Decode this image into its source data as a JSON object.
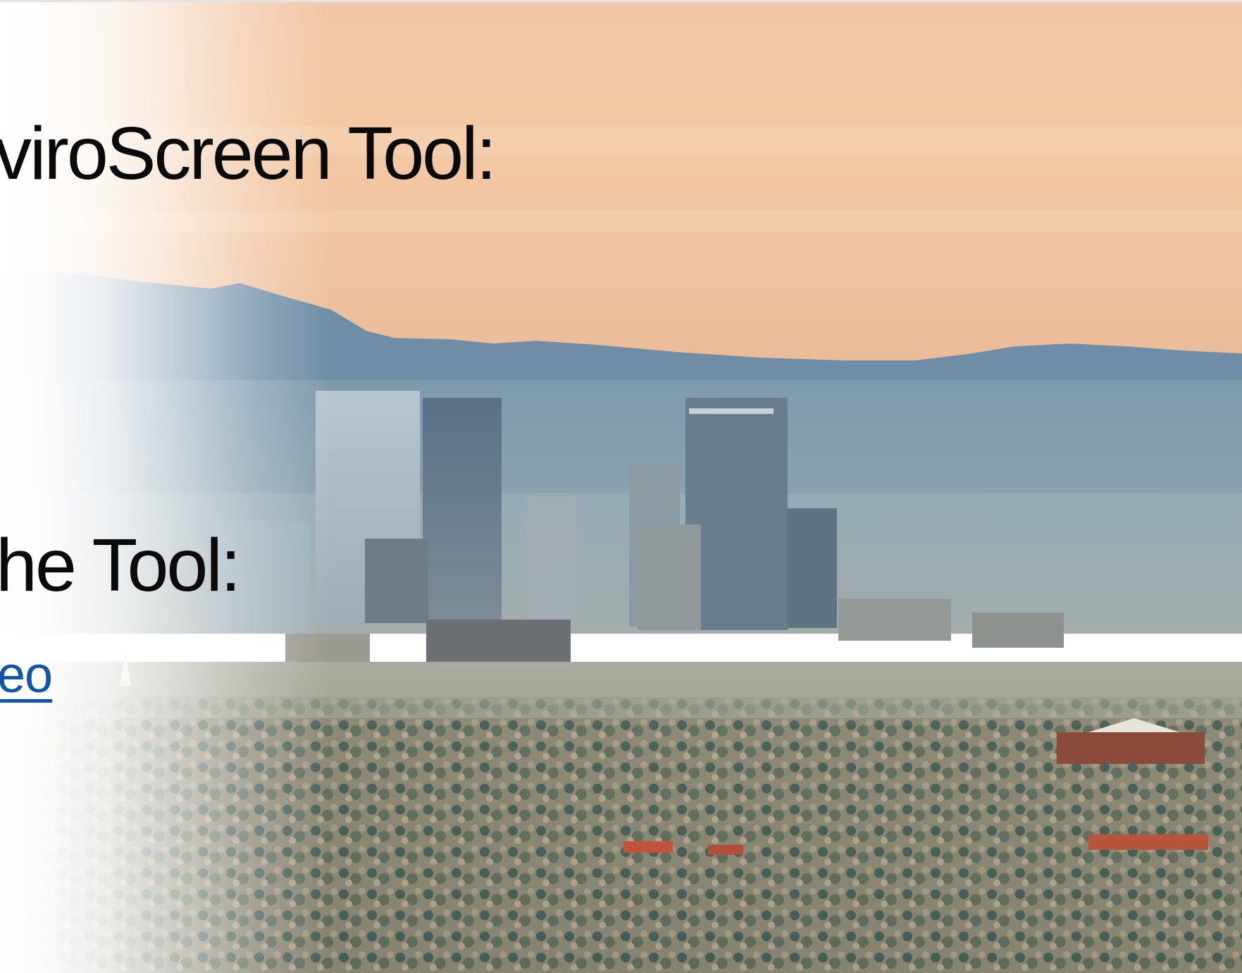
{
  "slide": {
    "heading_top": "viroScreen Tool:",
    "heading_bottom": "he Tool:",
    "video_link": "eo"
  },
  "colors": {
    "sky_top": "#f4c7a4",
    "mountains": "#6f8ea6",
    "haze": "#93a7b2",
    "link": "#1155aa",
    "text": "#0a0a0a"
  }
}
